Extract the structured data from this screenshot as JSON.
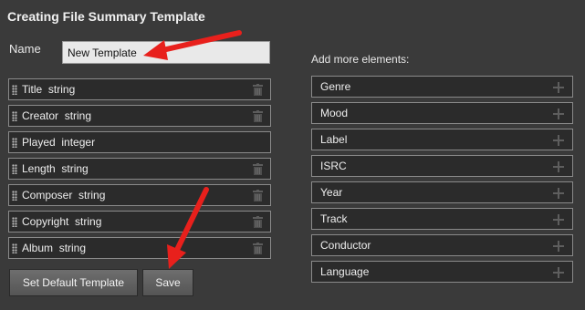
{
  "dialog": {
    "title": "Creating File Summary Template",
    "name_label": "Name",
    "name_value": "New Template",
    "add_more_label": "Add more elements:"
  },
  "fields": [
    {
      "name": "Title",
      "type": "string",
      "removable": true
    },
    {
      "name": "Creator",
      "type": "string",
      "removable": true
    },
    {
      "name": "Played",
      "type": "integer",
      "removable": false
    },
    {
      "name": "Length",
      "type": "string",
      "removable": true
    },
    {
      "name": "Composer",
      "type": "string",
      "removable": true
    },
    {
      "name": "Copyright",
      "type": "string",
      "removable": true
    },
    {
      "name": "Album",
      "type": "string",
      "removable": true
    }
  ],
  "available_elements": [
    "Genre",
    "Mood",
    "Label",
    "ISRC",
    "Year",
    "Track",
    "Conductor",
    "Language"
  ],
  "buttons": {
    "set_default": "Set Default Template",
    "save": "Save"
  },
  "icons": {
    "drag": "grip-icon",
    "delete": "trash-icon",
    "add": "plus-icon",
    "annotation": "red-arrow"
  },
  "colors": {
    "background": "#3a3a3a",
    "row_background": "#2b2b2b",
    "annotation_arrow": "#e8201c"
  }
}
